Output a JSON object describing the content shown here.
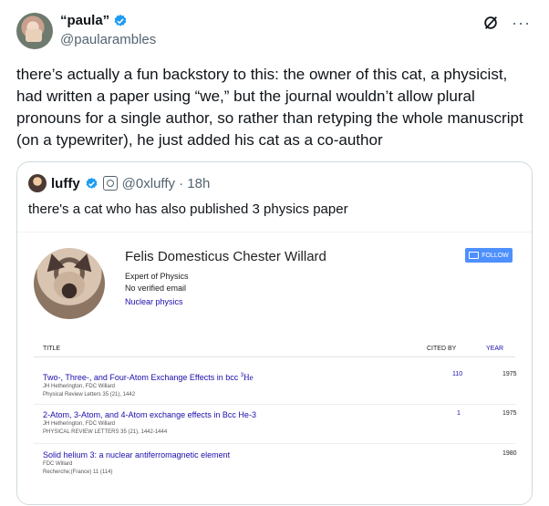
{
  "author": {
    "display_name": "“paula”",
    "handle": "@paularambles"
  },
  "tweet_text": "there’s actually a fun backstory to this: the owner of this cat, a physicist, had written a paper using “we,” but the journal wouldn’t allow plural pronouns for a single author, so rather than retyping the whole manuscript (on a typewriter), he just added his cat as a co-author",
  "quote": {
    "name": "luffy",
    "handle_time": "@0xluffy · 18h",
    "text": "there's a cat who has also published 3 physics paper",
    "scholar": {
      "name": "Felis Domesticus Chester Willard",
      "affiliation": "Expert of Physics",
      "email": "No verified email",
      "interest": "Nuclear physics",
      "follow_label": "FOLLOW",
      "headers": {
        "title": "TITLE",
        "cited_by": "CITED BY",
        "year": "YEAR"
      },
      "papers": [
        {
          "title": "Two-, Three-, and Four-Atom Exchange Effects in bcc",
          "title_sup": "3",
          "title_suffix": "He",
          "authors": "JH Hetherington, FDC Willard",
          "venue": "Physical Review Letters 35 (21), 1442",
          "cited_by": "110",
          "year": "1975"
        },
        {
          "title": "2-Atom, 3-Atom, and 4-Atom exchange effects in Bcc He-3",
          "authors": "JH Hetherington, FDC Willard",
          "venue": "PHYSICAL REVIEW LETTERS 35 (21), 1442-1444",
          "cited_by": "1",
          "year": "1975"
        },
        {
          "title": "Solid helium 3: a nuclear antiferromagnetic element",
          "authors": "FDC Willard",
          "venue": "Recherche;(France) 11 (114)",
          "cited_by": "",
          "year": "1980"
        }
      ]
    }
  },
  "colors": {
    "verified": "#1d9bf0",
    "link": "#1a0dab",
    "follow": "#4d90fe"
  }
}
